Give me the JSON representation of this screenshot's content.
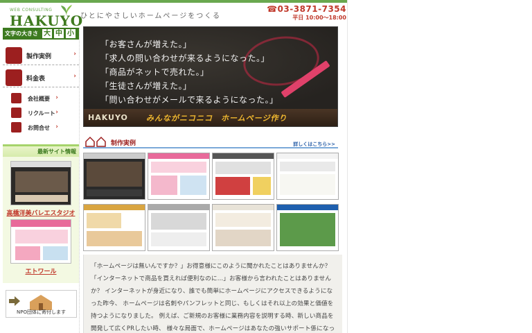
{
  "header": {
    "logo_sub": "WEB CONSULTING",
    "logo_main": "HAKUYO",
    "tagline": "ひとにやさしいホームページをつくる",
    "phone": "☎03-3871-7354",
    "hours": "平日 10:00〜18:00"
  },
  "fontsize": {
    "label": "文字の大きさ",
    "large": "大",
    "medium": "中",
    "small": "小"
  },
  "nav": {
    "works": "製作実例",
    "price": "料金表",
    "company": "会社概要",
    "recruit": "リクルート",
    "contact": "お問合せ",
    "arrow": "›"
  },
  "latest": {
    "title": "最新サイト情報",
    "site1": "高橋洋美バレエスタジオ",
    "site2": "エトワール"
  },
  "npo": {
    "label": "NPO団体に寄付します"
  },
  "hero": {
    "quotes": [
      "「お客さんが増えた。」",
      "「求人の問い合わせが来るようになった。」",
      "「商品がネットで売れた。」",
      "「生徒さんが増えた。」",
      "「問い合わせがメールで来るようになった。」"
    ],
    "brand": "HAKUYO",
    "slogan": "みんながニコニコ　ホームページ作り"
  },
  "works": {
    "title": "制作実例",
    "more": "詳しくはこちら>>"
  },
  "intro": {
    "text": "「ホームページは無いんですか？」お得意様にこのように聞かれたことはありませんか？「インターネットで商品を買えれば便利なのに…」お客様から言われたことはありませんか？ インターネットが身近になり、誰でも簡単にホームページにアクセスできるようになった昨今、 ホームページは名刺やパンフレットと同じ、もしくはそれ以上の効果と価値を持つようになりました。 例えば、ご新規のお客様に業務内容を説明する時、新しい商品を開発して広くPRしたい時、 様々な局面で、ホームページはあなたの強いサポート係になってくれます。 いつもの名刺にもっとっとホームページのアドレスを添えるだけ"
  },
  "colors": {
    "brand_green": "#3c7a1f",
    "accent_red": "#c0392b",
    "nav_icon": "#9c1f1f"
  }
}
